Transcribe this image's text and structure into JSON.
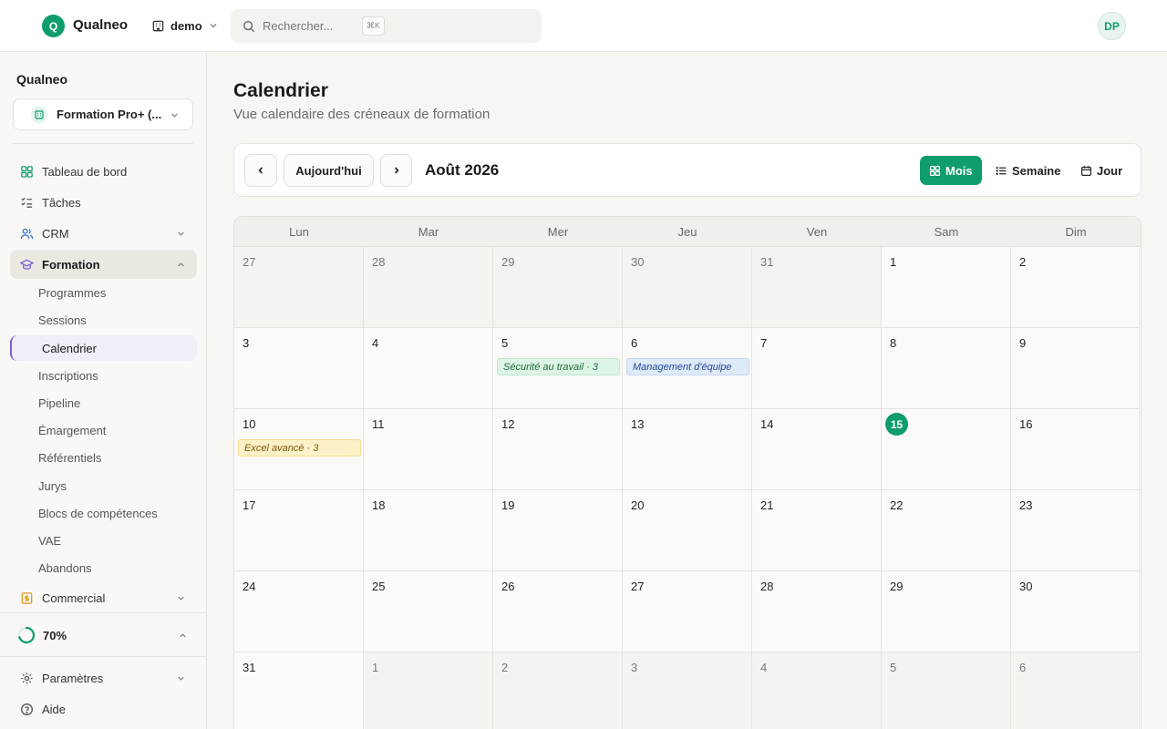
{
  "topbar": {
    "logo_letter": "Q",
    "brand": "Qualneo",
    "workspace": "demo",
    "search_placeholder": "Rechercher...",
    "search_shortcut": "⌘K",
    "avatar_initials": "DP"
  },
  "sidebar": {
    "org_title": "Qualneo",
    "org_select": "Formation Pro+ (...",
    "items": [
      {
        "label": "Tableau de bord"
      },
      {
        "label": "Tâches"
      },
      {
        "label": "CRM"
      },
      {
        "label": "Formation"
      }
    ],
    "formation_sub": [
      {
        "label": "Programmes"
      },
      {
        "label": "Sessions"
      },
      {
        "label": "Calendrier"
      },
      {
        "label": "Inscriptions"
      },
      {
        "label": "Pipeline"
      },
      {
        "label": "Émargement"
      },
      {
        "label": "Référentiels"
      },
      {
        "label": "Jurys"
      },
      {
        "label": "Blocs de compétences"
      },
      {
        "label": "VAE"
      },
      {
        "label": "Abandons"
      }
    ],
    "commercial": "Commercial",
    "progress": {
      "label": "70%",
      "value": 0.7
    },
    "settings": "Paramètres",
    "help": "Aide"
  },
  "main": {
    "title": "Calendrier",
    "subtitle": "Vue calendaire des créneaux de formation",
    "today_label": "Aujourd'hui",
    "month_label": "Août 2026",
    "views": {
      "month": "Mois",
      "week": "Semaine",
      "day": "Jour"
    }
  },
  "calendar": {
    "weekdays": [
      "Lun",
      "Mar",
      "Mer",
      "Jeu",
      "Ven",
      "Sam",
      "Dim"
    ],
    "weeks": [
      [
        {
          "d": "27",
          "o": true
        },
        {
          "d": "28",
          "o": true
        },
        {
          "d": "29",
          "o": true
        },
        {
          "d": "30",
          "o": true
        },
        {
          "d": "31",
          "o": true
        },
        {
          "d": "1"
        },
        {
          "d": "2"
        }
      ],
      [
        {
          "d": "3"
        },
        {
          "d": "4"
        },
        {
          "d": "5",
          "ev": {
            "text": "Sécurité au travail · 3",
            "color": "green"
          }
        },
        {
          "d": "6",
          "ev": {
            "text": "Management d'équipe",
            "color": "blue"
          }
        },
        {
          "d": "7"
        },
        {
          "d": "8"
        },
        {
          "d": "9"
        }
      ],
      [
        {
          "d": "10",
          "ev": {
            "text": "Excel avancé · 3",
            "color": "yellow"
          }
        },
        {
          "d": "11"
        },
        {
          "d": "12"
        },
        {
          "d": "13"
        },
        {
          "d": "14"
        },
        {
          "d": "15",
          "today": true
        },
        {
          "d": "16"
        }
      ],
      [
        {
          "d": "17"
        },
        {
          "d": "18"
        },
        {
          "d": "19"
        },
        {
          "d": "20"
        },
        {
          "d": "21"
        },
        {
          "d": "22"
        },
        {
          "d": "23"
        }
      ],
      [
        {
          "d": "24"
        },
        {
          "d": "25"
        },
        {
          "d": "26"
        },
        {
          "d": "27"
        },
        {
          "d": "28"
        },
        {
          "d": "29"
        },
        {
          "d": "30"
        }
      ],
      [
        {
          "d": "31"
        },
        {
          "d": "1",
          "o": true
        },
        {
          "d": "2",
          "o": true
        },
        {
          "d": "3",
          "o": true
        },
        {
          "d": "4",
          "o": true
        },
        {
          "d": "5",
          "o": true
        },
        {
          "d": "6",
          "o": true
        }
      ]
    ]
  },
  "colors": {
    "accent": "#0f9d6e",
    "active_sub_border": "#7b61d9"
  }
}
